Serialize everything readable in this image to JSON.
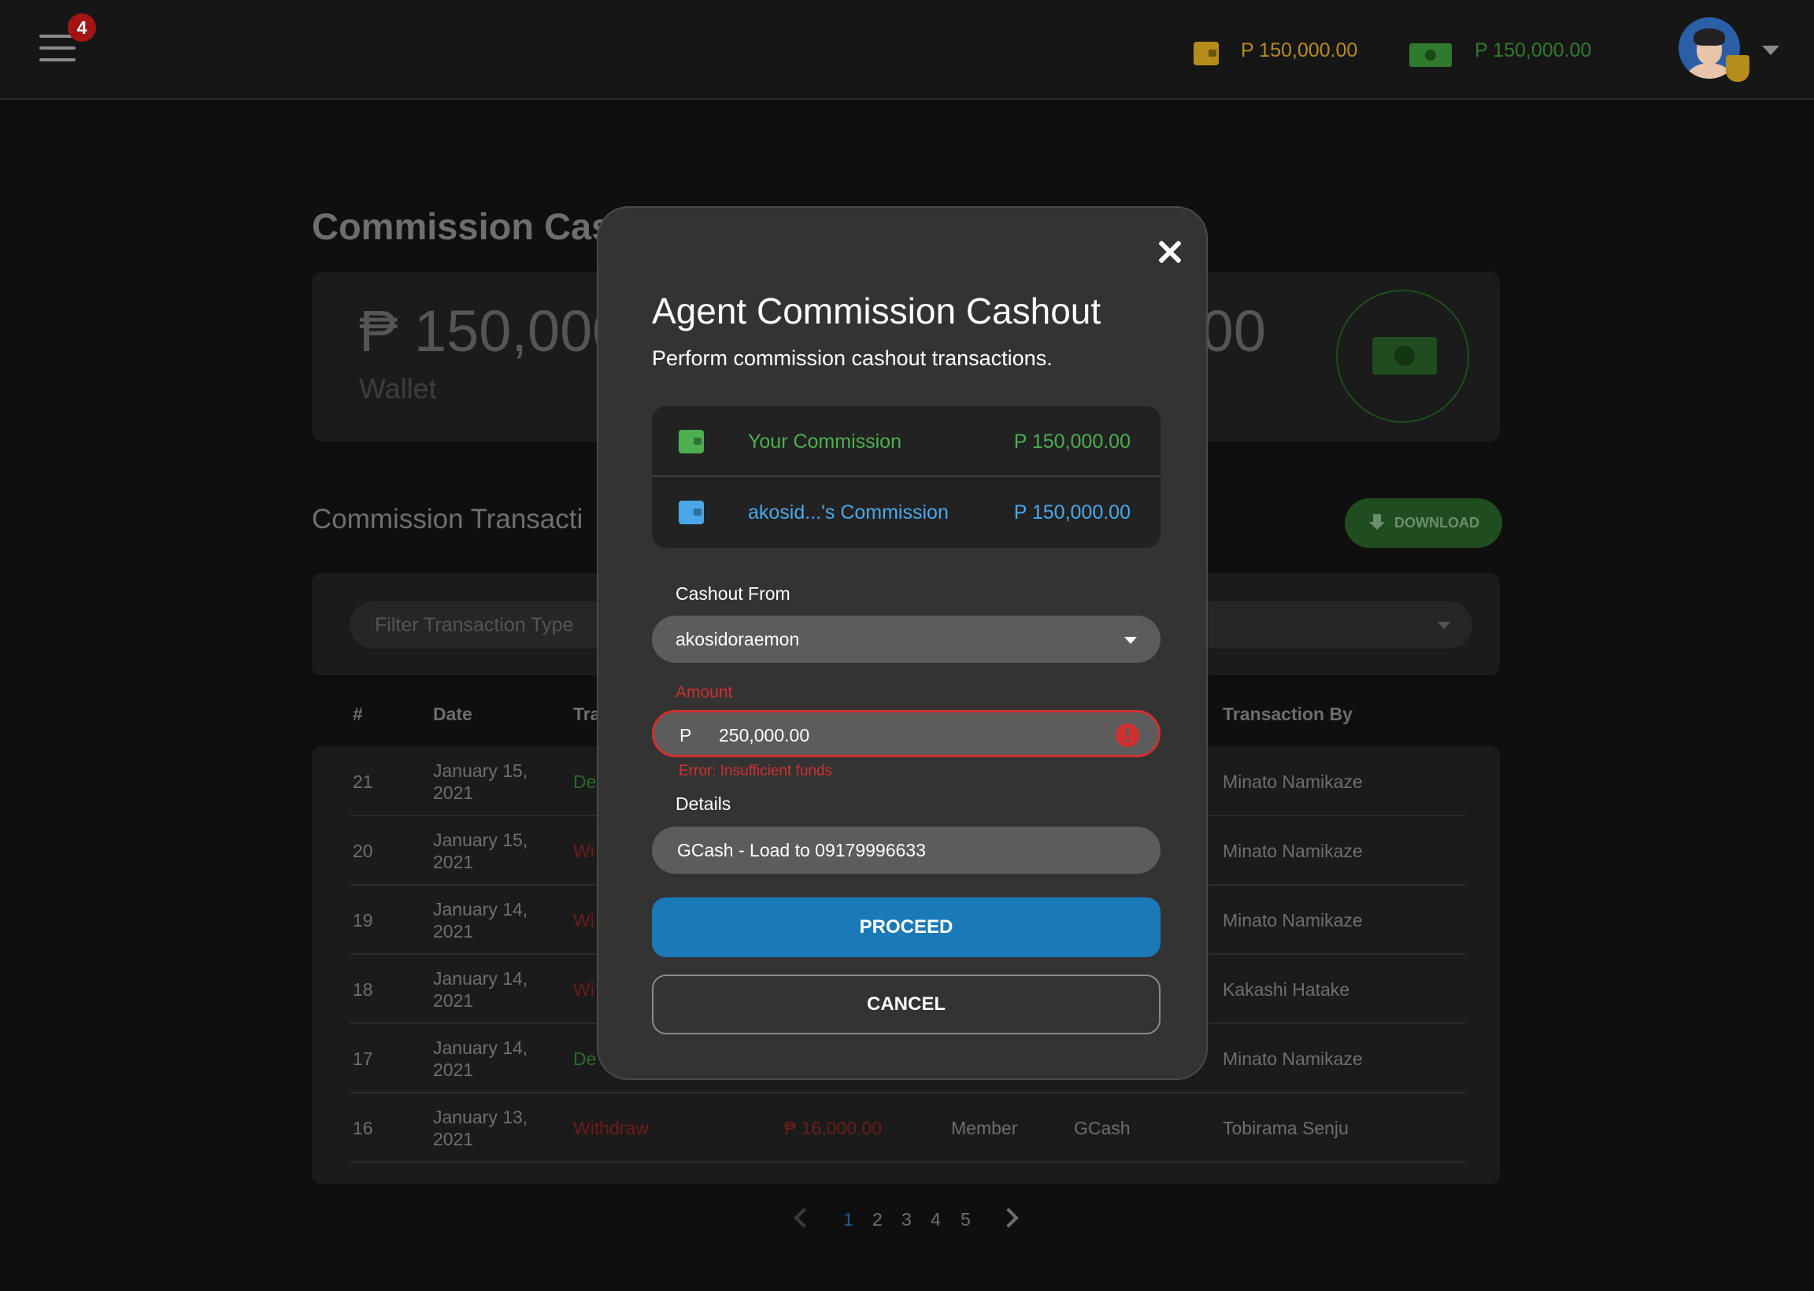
{
  "header": {
    "notification_count": "4",
    "wallet_balance": "P 150,000.00",
    "cash_balance": "P 150,000.00"
  },
  "page": {
    "title": "Commission Cash",
    "summary_amount": "₱ 150,000",
    "summary_label": "Wallet",
    "summary_amount_right": ".00",
    "section_title": "Commission Transacti",
    "download_label": "DOWNLOAD",
    "filter_placeholder": "Filter Transaction Type"
  },
  "table": {
    "headers": [
      "#",
      "Date",
      "Tra",
      "Transaction By"
    ],
    "rows": [
      {
        "num": "21",
        "date": "January 15, 2021",
        "type": "De",
        "amount": "",
        "role": "",
        "channel": "",
        "by": "Minato Namikaze",
        "kind": "green"
      },
      {
        "num": "20",
        "date": "January 15, 2021",
        "type": "Wi",
        "amount": "",
        "role": "",
        "channel": "",
        "by": "Minato Namikaze",
        "kind": "red"
      },
      {
        "num": "19",
        "date": "January 14, 2021",
        "type": "Wi",
        "amount": "",
        "role": "",
        "channel": "",
        "by": "Minato Namikaze",
        "kind": "red"
      },
      {
        "num": "18",
        "date": "January 14, 2021",
        "type": "Wi",
        "amount": "",
        "role": "",
        "channel": "",
        "by": "Kakashi Hatake",
        "kind": "red"
      },
      {
        "num": "17",
        "date": "January 14, 2021",
        "type": "De",
        "amount": "",
        "role": "",
        "channel": "",
        "by": "Minato Namikaze",
        "kind": "green"
      },
      {
        "num": "16",
        "date": "January 13, 2021",
        "type": "Withdraw",
        "amount": "₱ 16,000.00",
        "role": "Member",
        "channel": "GCash",
        "by": "Tobirama Senju",
        "kind": "red"
      }
    ]
  },
  "pagination": {
    "pages": [
      "1",
      "2",
      "3",
      "4",
      "5"
    ],
    "active": "1"
  },
  "modal": {
    "title": "Agent Commission Cashout",
    "subtitle": "Perform commission cashout transactions.",
    "your_commission_label": "Your Commission",
    "your_commission_value": "P 150,000.00",
    "other_commission_label": "akosid...'s Commission",
    "other_commission_value": "P 150,000.00",
    "cashout_from_label": "Cashout From",
    "cashout_from_value": "akosidoraemon",
    "amount_label": "Amount",
    "amount_prefix": "P",
    "amount_value": "250,000.00",
    "amount_error": "Error: Insufficient funds",
    "details_label": "Details",
    "details_value": "GCash - Load to 09179996633",
    "proceed_label": "PROCEED",
    "cancel_label": "CANCEL"
  },
  "colors": {
    "wallet": "#b58c1b",
    "cash": "#2f7a2e",
    "commission_green": "#4caf50",
    "commission_blue": "#4aa8ea",
    "error": "#d23030",
    "primary_button": "#1a7ab8"
  },
  "icons": {
    "menu": "menu-icon",
    "wallet": "wallet-icon",
    "cash": "cash-icon",
    "close": "close-icon",
    "error": "error-icon",
    "download": "download-icon"
  }
}
